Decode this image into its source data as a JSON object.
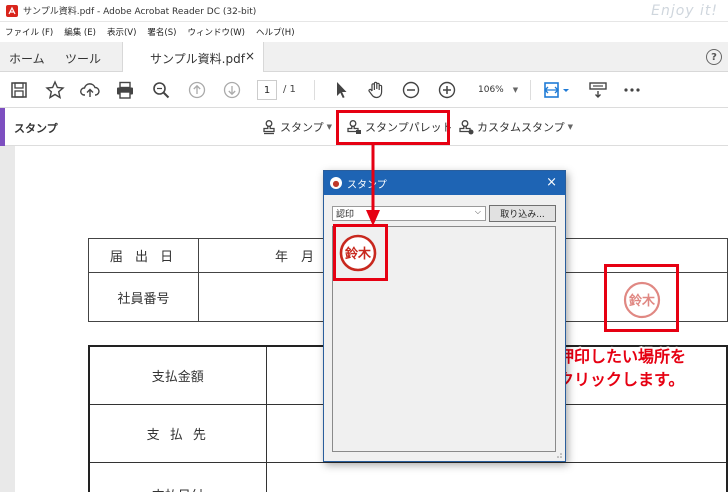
{
  "window": {
    "title": "サンプル資料.pdf - Adobe Acrobat Reader DC (32-bit)",
    "watermark": "Enjoy it!"
  },
  "menu": [
    "ファイル (F)",
    "編集 (E)",
    "表示(V)",
    "署名(S)",
    "ウィンドウ(W)",
    "ヘルプ(H)"
  ],
  "tabs": {
    "home": "ホーム",
    "tools": "ツール",
    "document": "サンプル資料.pdf",
    "close": "×",
    "help": "?"
  },
  "toolbar": {
    "page_current": "1",
    "page_total": "/ 1",
    "zoom": "106%"
  },
  "stampbar": {
    "name": "スタンプ",
    "stamp_btn": "スタンプ",
    "palette_btn": "スタンプパレット",
    "custom_btn": "カスタムスタンプ"
  },
  "form1": {
    "date_label": "届 出 日",
    "date_value": "年　月",
    "employee_label": "社員番号"
  },
  "form2": {
    "row1": "支払金額",
    "row2": "支 払 先",
    "row3": "支払日付"
  },
  "dialog": {
    "title": "スタンプ",
    "close": "×",
    "category": "認印",
    "import_btn": "取り込み...",
    "stamp_text": "鈴木"
  },
  "placed_stamp_text": "鈴木",
  "callout": {
    "line1": "押印したい場所を",
    "line2": "クリックします。"
  },
  "colors": {
    "accent": "#e60012",
    "dialog_title": "#1e64b4",
    "stamp_ink": "#c8281e",
    "stamp_tool_accent": "#7d4fc0"
  }
}
